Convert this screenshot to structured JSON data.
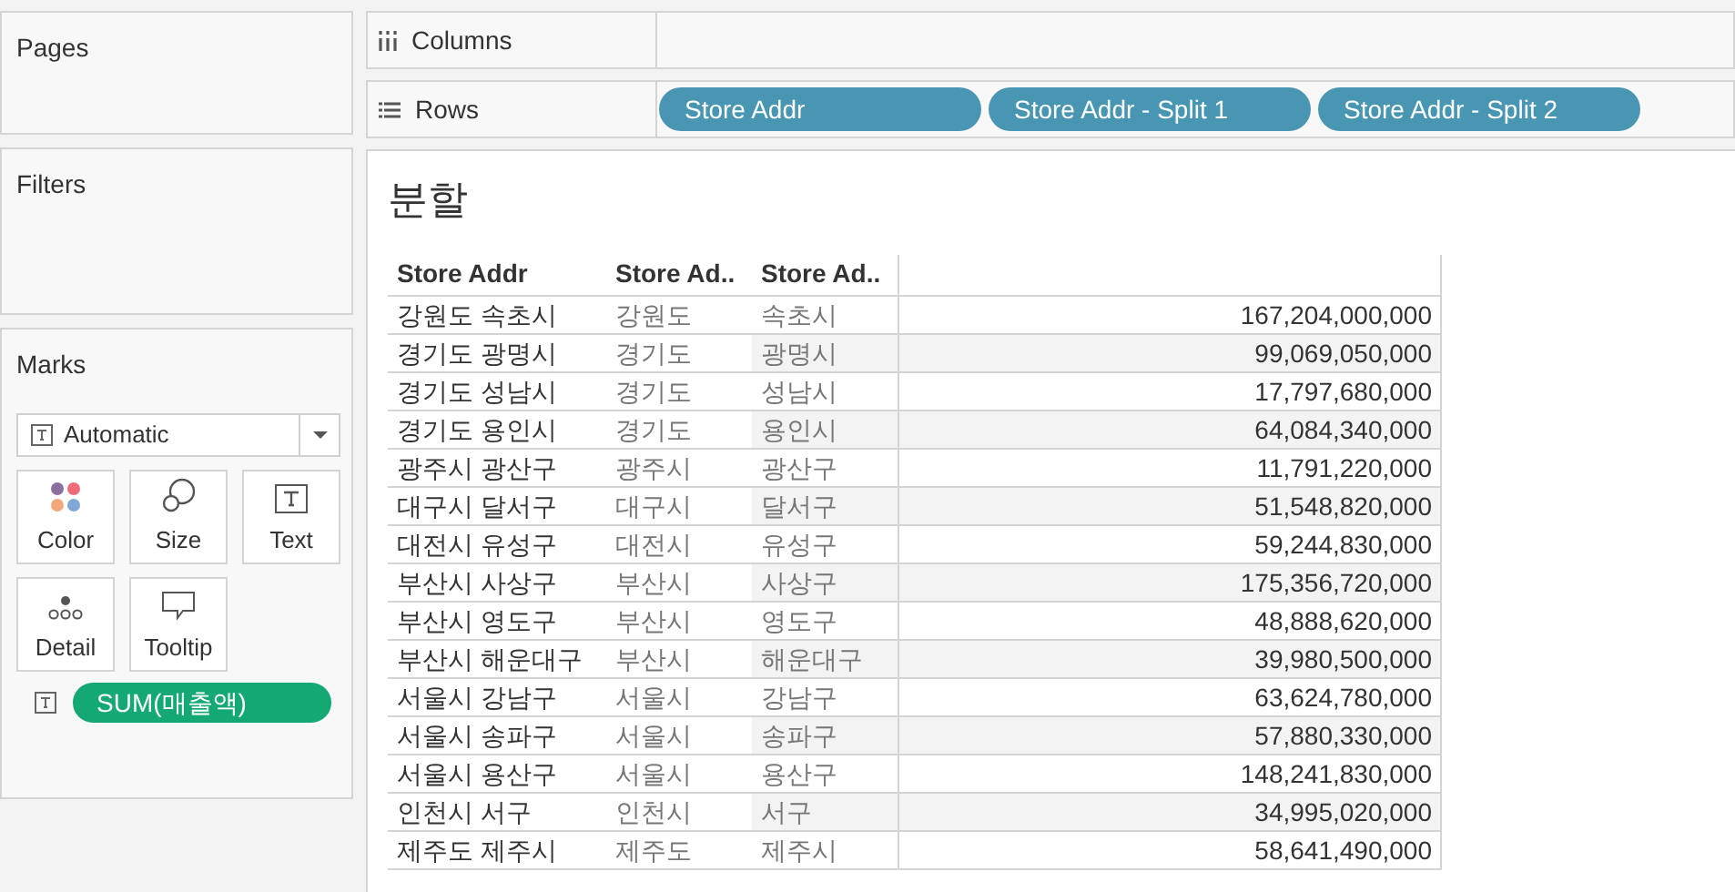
{
  "pages": {
    "title": "Pages"
  },
  "filters": {
    "title": "Filters"
  },
  "marks": {
    "title": "Marks",
    "mark_type": "Automatic",
    "buttons": [
      {
        "kind": "color",
        "label": "Color"
      },
      {
        "kind": "size",
        "label": "Size"
      },
      {
        "kind": "text",
        "label": "Text"
      },
      {
        "kind": "detail",
        "label": "Detail"
      },
      {
        "kind": "tooltip",
        "label": "Tooltip"
      }
    ],
    "fields": [
      {
        "kind": "text",
        "label": "SUM(매출액)"
      }
    ]
  },
  "shelves": [
    {
      "kind": "columns",
      "label": "Columns"
    },
    {
      "kind": "rows",
      "label": "Rows",
      "pills": [
        "Store Addr",
        "Store Addr - Split 1",
        "Store Addr - Split 2"
      ]
    }
  ],
  "sheet": {
    "title": "분할",
    "columns": [
      "Store Addr",
      "Store Ad..",
      "Store Ad.."
    ],
    "rows": [
      [
        "강원도 속초시",
        "강원도",
        "속초시",
        "167,204,000,000"
      ],
      [
        "경기도 광명시",
        "경기도",
        "광명시",
        "99,069,050,000"
      ],
      [
        "경기도 성남시",
        "경기도",
        "성남시",
        "17,797,680,000"
      ],
      [
        "경기도 용인시",
        "경기도",
        "용인시",
        "64,084,340,000"
      ],
      [
        "광주시 광산구",
        "광주시",
        "광산구",
        "11,791,220,000"
      ],
      [
        "대구시 달서구",
        "대구시",
        "달서구",
        "51,548,820,000"
      ],
      [
        "대전시 유성구",
        "대전시",
        "유성구",
        "59,244,830,000"
      ],
      [
        "부산시 사상구",
        "부산시",
        "사상구",
        "175,356,720,000"
      ],
      [
        "부산시 영도구",
        "부산시",
        "영도구",
        "48,888,620,000"
      ],
      [
        "부산시 해운대구",
        "부산시",
        "해운대구",
        "39,980,500,000"
      ],
      [
        "서울시 강남구",
        "서울시",
        "강남구",
        "63,624,780,000"
      ],
      [
        "서울시 송파구",
        "서울시",
        "송파구",
        "57,880,330,000"
      ],
      [
        "서울시 용산구",
        "서울시",
        "용산구",
        "148,241,830,000"
      ],
      [
        "인천시 서구",
        "인천시",
        "서구",
        "34,995,020,000"
      ],
      [
        "제주도 제주시",
        "제주도",
        "제주시",
        "58,641,490,000"
      ]
    ]
  }
}
